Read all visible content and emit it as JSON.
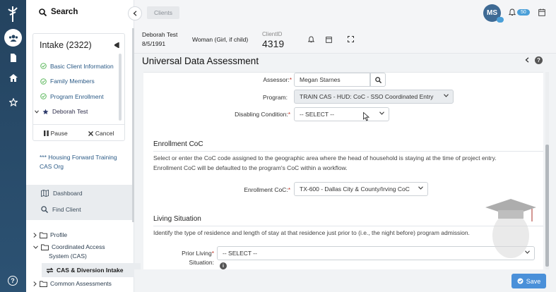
{
  "sidebar": {
    "search_label": "Search",
    "intake_title": "Intake (2322)",
    "intake_items": [
      {
        "label": "Basic Client Information",
        "status": "done"
      },
      {
        "label": "Family Members",
        "status": "done"
      },
      {
        "label": "Program Enrollment",
        "status": "done"
      },
      {
        "label": "Deborah Test",
        "status": "current"
      }
    ],
    "pause_label": "Pause",
    "cancel_label": "Cancel",
    "org_label": "*** Housing Forward Training CAS Org",
    "tools": [
      {
        "label": "Dashboard",
        "icon": "map-icon"
      },
      {
        "label": "Find Client",
        "icon": "search-icon"
      }
    ],
    "tree": {
      "profile": "Profile",
      "cas_line1": "Coordinated Access",
      "cas_line2": "System (CAS)",
      "cas_child": "CAS & Diversion Intake",
      "common": "Common Assessments"
    }
  },
  "topbar": {
    "breadcrumb": "Clients",
    "avatar_initials": "MS",
    "notification_count": "50"
  },
  "client": {
    "name": "Deborah Test",
    "dob": "8/5/1991",
    "gender": "Woman (Girl, if child)",
    "client_id_label": "ClientID",
    "client_id": "4319"
  },
  "page": {
    "title": "Universal Data Assessment"
  },
  "form": {
    "assessor_label": "Assessor:",
    "assessor_value": "Megan Starnes",
    "program_label": "Program:",
    "program_value": "TRAIN CAS - HUD: CoC - SSO Coordinated Entry",
    "disabling_label": "Disabling Condition:",
    "disabling_value": "-- SELECT --",
    "enrollment_section": "Enrollment CoC",
    "enrollment_desc1": "Select or enter the CoC code assigned to the geographic area where the head of household is staying at the time of project entry.",
    "enrollment_desc2": "Enrollment CoC will be defaulted to the program's CoC within a workflow.",
    "enrollment_label": "Enrollment CoC:",
    "enrollment_value": "TX-600 - Dallas City & County/Irving CoC",
    "living_section": "Living Situation",
    "living_desc": "Identify the type of residence and length of stay at that residence just prior to (i.e., the night before) program admission.",
    "prior_label_1": "Prior Living",
    "prior_label_2": "Situation:",
    "prior_value": "-- SELECT --"
  },
  "actions": {
    "save_label": "Save"
  },
  "colors": {
    "rail": "#24435f",
    "accent": "#4a90d9",
    "success": "#5cb85c",
    "required": "#c0392b"
  }
}
